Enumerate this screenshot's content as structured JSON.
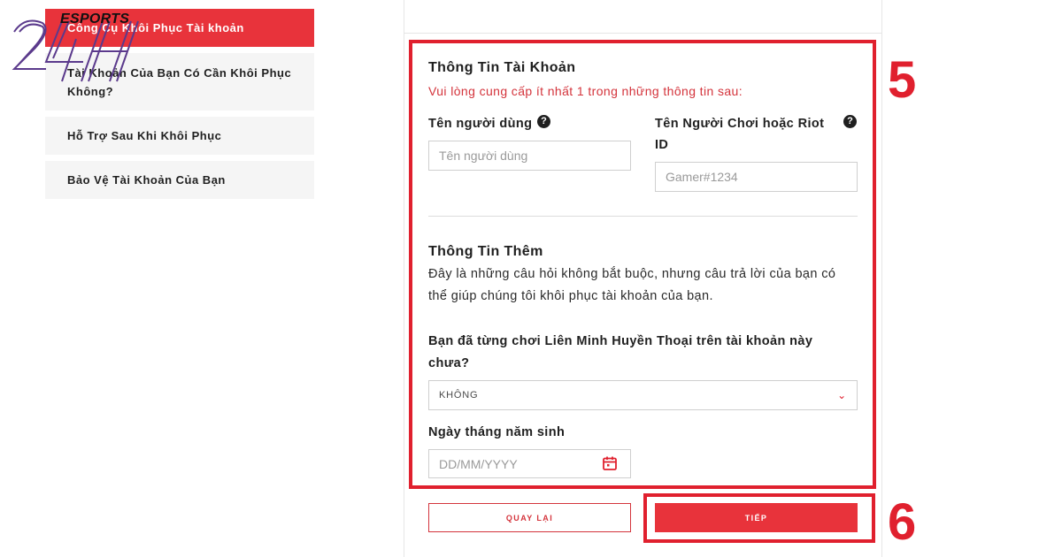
{
  "sidebar": {
    "items": [
      {
        "label": "Công Cụ Khôi Phục Tài khoản",
        "active": true
      },
      {
        "label": "Tài Khoản Của Bạn Có Cần Khôi Phục Không?"
      },
      {
        "label": "Hỗ Trợ Sau Khi Khôi Phục"
      },
      {
        "label": "Bảo Vệ Tài Khoản Của Bạn"
      }
    ]
  },
  "logo": {
    "text": "ESPORTS",
    "mark": "24H"
  },
  "form": {
    "account_section_title": "Thông Tin Tài Khoản",
    "account_hint": "Vui lòng cung cấp ít nhất 1 trong những thông tin sau:",
    "username": {
      "label": "Tên người dùng",
      "placeholder": "Tên người dùng",
      "help_icon": "question-icon"
    },
    "riot_id": {
      "label": "Tên Người Chơi hoặc Riot ID",
      "placeholder": "Gamer#1234",
      "help_icon": "question-icon"
    },
    "extra_section_title": "Thông Tin Thêm",
    "extra_description": "Đây là những câu hỏi không bắt buộc, nhưng câu trả lời của bạn có thể giúp chúng tôi khôi phục tài khoản của bạn.",
    "played_lol_question": "Bạn đã từng chơi Liên Minh Huyền Thoại trên tài khoản này chưa?",
    "played_lol_value": "KHÔNG",
    "dob": {
      "label": "Ngày tháng năm sinh",
      "placeholder": "DD/MM/YYYY",
      "icon": "calendar-icon"
    },
    "back_label": "QUAY LẠI",
    "next_label": "TIẾP"
  },
  "annotations": {
    "step_form": "5",
    "step_next": "6"
  },
  "colors": {
    "accent": "#e8333b",
    "highlight": "#e0202e",
    "hint": "#d4343c"
  }
}
